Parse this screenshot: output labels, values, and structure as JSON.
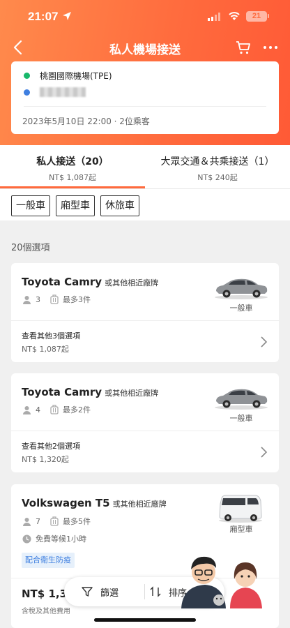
{
  "status": {
    "time": "21:07",
    "battery": "21"
  },
  "nav": {
    "title": "私人機場接送"
  },
  "trip": {
    "from": "桃園國際機場(TPE)",
    "to": "",
    "info": "2023年5月10日 22:00 · 2位乘客"
  },
  "tabs": [
    {
      "label": "私人接送（20）",
      "sub": "NT$ 1,087起"
    },
    {
      "label": "大眾交通＆共乘接送（1）",
      "sub": "NT$ 240起"
    }
  ],
  "filters": [
    "一般車",
    "廂型車",
    "休旅車"
  ],
  "result_count": "20個選項",
  "cards": [
    {
      "name": "Toyota Camry",
      "suffix": "或其他相近廠牌",
      "passengers": "3",
      "luggage": "最多3件",
      "type": "一般車",
      "more_options": "查看其他3個選項",
      "price": "NT$ 1,087起"
    },
    {
      "name": "Toyota Camry",
      "suffix": "或其他相近廠牌",
      "passengers": "4",
      "luggage": "最多2件",
      "type": "一般車",
      "more_options": "查看其他2個選項",
      "price": "NT$ 1,320起"
    },
    {
      "name": "Volkswagen T5",
      "suffix": "或其他相近廠牌",
      "passengers": "7",
      "luggage": "最多5件",
      "wait": "免費等候1小時",
      "badge": "配合衛生防疫",
      "type": "廂型車",
      "price": "NT$ 1,38",
      "price_note": "含稅及其他費用"
    }
  ],
  "float_bar": {
    "filter": "篩選",
    "sort": "排序"
  },
  "colors": {
    "accent": "#ff6a3d",
    "green_dot": "#18b86b",
    "blue_dot": "#3f7fe0",
    "badge_bg": "#e6f0fb"
  }
}
